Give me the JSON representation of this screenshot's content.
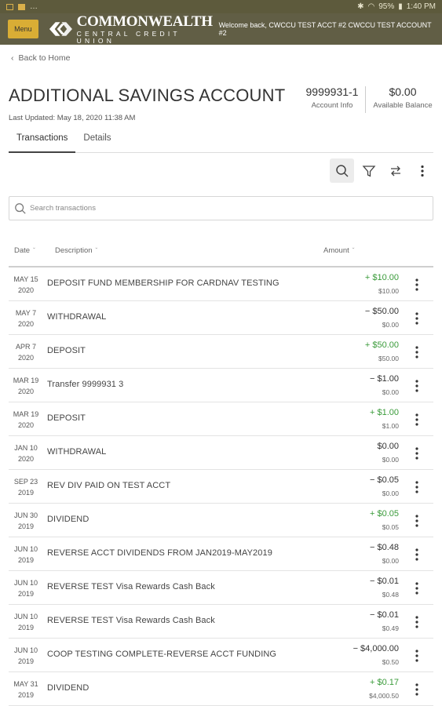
{
  "status_bar": {
    "left_icons": [
      "notification-icon",
      "notification-icon",
      "overflow-dots-icon"
    ],
    "battery": "95%",
    "time": "1:40 PM"
  },
  "header": {
    "menu_label": "Menu",
    "logo_main": "COMMONWEALTH",
    "logo_sub": "CENTRAL CREDIT UNION",
    "welcome": "Welcome back, CWCCU TEST ACCT #2 CWCCU TEST ACCOUNT #2"
  },
  "back_link": "Back to Home",
  "account": {
    "title": "ADDITIONAL SAVINGS ACCOUNT",
    "last_updated": "Last Updated: May 18, 2020 11:38 AM",
    "number": "9999931-1",
    "number_label": "Account Info",
    "balance": "$0.00",
    "balance_label": "Available Balance"
  },
  "tabs": [
    {
      "label": "Transactions",
      "active": true
    },
    {
      "label": "Details",
      "active": false
    }
  ],
  "toolbar": [
    "search-icon",
    "filter-icon",
    "transfer-icon",
    "more-icon"
  ],
  "search": {
    "placeholder": "Search transactions",
    "value": ""
  },
  "columns": {
    "date": "Date",
    "description": "Description",
    "amount": "Amount"
  },
  "colors": {
    "header_bg": "#615e45",
    "accent": "#d9ad35",
    "positive": "#3a9b3a"
  },
  "transactions": [
    {
      "date_md": "MAY 15",
      "date_y": "2020",
      "description": "DEPOSIT FUND MEMBERSHIP FOR CARDNAV TESTING",
      "amount": "+ $10.00",
      "balance": "$10.00",
      "positive": true
    },
    {
      "date_md": "MAY 7",
      "date_y": "2020",
      "description": "WITHDRAWAL",
      "amount": "− $50.00",
      "balance": "$0.00",
      "positive": false
    },
    {
      "date_md": "APR 7",
      "date_y": "2020",
      "description": "DEPOSIT",
      "amount": "+ $50.00",
      "balance": "$50.00",
      "positive": true
    },
    {
      "date_md": "MAR 19",
      "date_y": "2020",
      "description": "Transfer 9999931 3",
      "amount": "− $1.00",
      "balance": "$0.00",
      "positive": false
    },
    {
      "date_md": "MAR 19",
      "date_y": "2020",
      "description": "DEPOSIT",
      "amount": "+ $1.00",
      "balance": "$1.00",
      "positive": true
    },
    {
      "date_md": "JAN 10",
      "date_y": "2020",
      "description": "WITHDRAWAL",
      "amount": "$0.00",
      "balance": "$0.00",
      "positive": false
    },
    {
      "date_md": "SEP 23",
      "date_y": "2019",
      "description": "REV DIV PAID ON TEST ACCT",
      "amount": "− $0.05",
      "balance": "$0.00",
      "positive": false
    },
    {
      "date_md": "JUN 30",
      "date_y": "2019",
      "description": "DIVIDEND",
      "amount": "+ $0.05",
      "balance": "$0.05",
      "positive": true
    },
    {
      "date_md": "JUN 10",
      "date_y": "2019",
      "description": "REVERSE ACCT DIVIDENDS FROM JAN2019-MAY2019",
      "amount": "− $0.48",
      "balance": "$0.00",
      "positive": false
    },
    {
      "date_md": "JUN 10",
      "date_y": "2019",
      "description": "REVERSE TEST Visa Rewards Cash Back",
      "amount": "− $0.01",
      "balance": "$0.48",
      "positive": false
    },
    {
      "date_md": "JUN 10",
      "date_y": "2019",
      "description": "REVERSE TEST Visa Rewards Cash Back",
      "amount": "− $0.01",
      "balance": "$0.49",
      "positive": false
    },
    {
      "date_md": "JUN 10",
      "date_y": "2019",
      "description": "COOP TESTING COMPLETE-REVERSE ACCT FUNDING",
      "amount": "− $4,000.00",
      "balance": "$0.50",
      "positive": false
    },
    {
      "date_md": "MAY 31",
      "date_y": "2019",
      "description": "DIVIDEND",
      "amount": "+ $0.17",
      "balance": "$4,000.50",
      "positive": true
    }
  ]
}
